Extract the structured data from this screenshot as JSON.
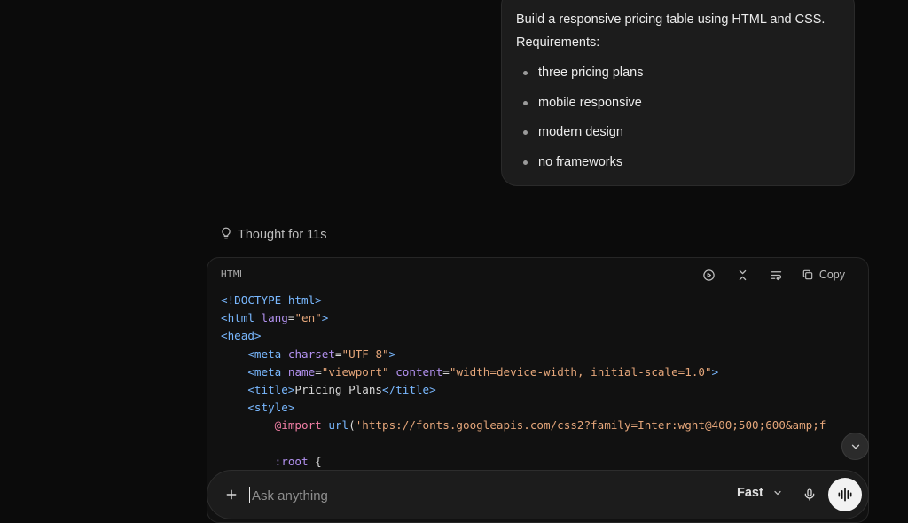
{
  "user_message": {
    "line1": "Build a responsive pricing table using HTML and CSS.",
    "line2": "Requirements:",
    "requirements": [
      "three pricing plans",
      "mobile responsive",
      "modern design",
      "no frameworks"
    ]
  },
  "thought": {
    "label": "Thought for 11s",
    "icon": "lightbulb-icon"
  },
  "code_block": {
    "language": "HTML",
    "copy_label": "Copy",
    "tools": [
      "play-icon",
      "collapse-icon",
      "wrap-icon",
      "copy-icon"
    ],
    "lines": [
      [
        {
          "c": "t-tag",
          "t": "<!DOCTYPE html>"
        }
      ],
      [
        {
          "c": "t-tag",
          "t": "<html"
        },
        {
          "c": "",
          "t": " "
        },
        {
          "c": "t-attr",
          "t": "lang"
        },
        {
          "c": "",
          "t": "="
        },
        {
          "c": "t-str",
          "t": "\"en\""
        },
        {
          "c": "t-tag",
          "t": ">"
        }
      ],
      [
        {
          "c": "t-tag",
          "t": "<head>"
        }
      ],
      [
        {
          "c": "",
          "t": "    "
        },
        {
          "c": "t-tag",
          "t": "<meta"
        },
        {
          "c": "",
          "t": " "
        },
        {
          "c": "t-attr",
          "t": "charset"
        },
        {
          "c": "",
          "t": "="
        },
        {
          "c": "t-str",
          "t": "\"UTF-8\""
        },
        {
          "c": "t-tag",
          "t": ">"
        }
      ],
      [
        {
          "c": "",
          "t": "    "
        },
        {
          "c": "t-tag",
          "t": "<meta"
        },
        {
          "c": "",
          "t": " "
        },
        {
          "c": "t-attr",
          "t": "name"
        },
        {
          "c": "",
          "t": "="
        },
        {
          "c": "t-str",
          "t": "\"viewport\""
        },
        {
          "c": "",
          "t": " "
        },
        {
          "c": "t-attr",
          "t": "content"
        },
        {
          "c": "",
          "t": "="
        },
        {
          "c": "t-str",
          "t": "\"width=device-width, initial-scale=1.0\""
        },
        {
          "c": "t-tag",
          "t": ">"
        }
      ],
      [
        {
          "c": "",
          "t": "    "
        },
        {
          "c": "t-tag",
          "t": "<title>"
        },
        {
          "c": "",
          "t": "Pricing Plans"
        },
        {
          "c": "t-tag",
          "t": "</title>"
        }
      ],
      [
        {
          "c": "",
          "t": "    "
        },
        {
          "c": "t-tag",
          "t": "<style>"
        }
      ],
      [
        {
          "c": "",
          "t": "        "
        },
        {
          "c": "t-at",
          "t": "@import"
        },
        {
          "c": "",
          "t": " "
        },
        {
          "c": "t-fn",
          "t": "url"
        },
        {
          "c": "",
          "t": "("
        },
        {
          "c": "t-str",
          "t": "'https://fonts.googleapis.com/css2?family=Inter:wght@400;500;600&amp;f"
        }
      ],
      [
        {
          "c": "",
          "t": ""
        }
      ],
      [
        {
          "c": "",
          "t": "        "
        },
        {
          "c": "t-attr",
          "t": ":root"
        },
        {
          "c": "",
          "t": " {"
        }
      ]
    ]
  },
  "input": {
    "placeholder": "Ask anything",
    "value": ""
  },
  "mode": {
    "label": "Fast"
  },
  "colors": {
    "background": "#0b0b0b",
    "bubble": "#1c1c1c",
    "voice_button": "#f2f2f2"
  }
}
